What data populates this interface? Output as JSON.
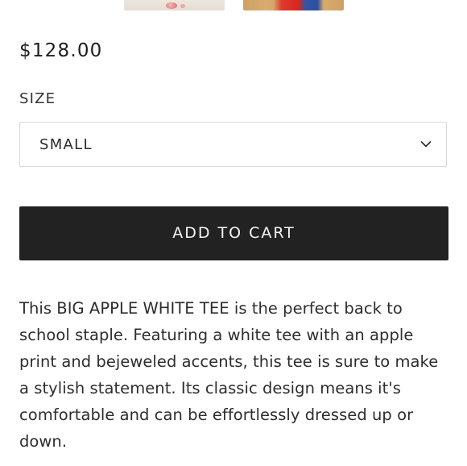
{
  "gallery": {
    "thumbnails": [
      "product-photo-thumbnail-1",
      "product-photo-thumbnail-2"
    ]
  },
  "product": {
    "price": "$128.00",
    "size_label": "SIZE",
    "size_selected": "SMALL",
    "add_to_cart_label": "ADD TO CART",
    "description_lines": [
      "This BIG APPLE WHITE TEE is the perfect back to",
      "school staple. Featuring a white tee with an apple",
      "print and bejeweled accents, this tee is sure to make",
      "a stylish statement. Its classic design means it's",
      "comfortable and can be effortlessly dressed up or",
      "down."
    ]
  },
  "colors": {
    "button_background": "#222222",
    "button_text": "#ffffff",
    "select_border": "#d9d9d9",
    "text": "#2d2d2d"
  },
  "icons": {
    "select_chevron": "chevron-down-icon"
  }
}
